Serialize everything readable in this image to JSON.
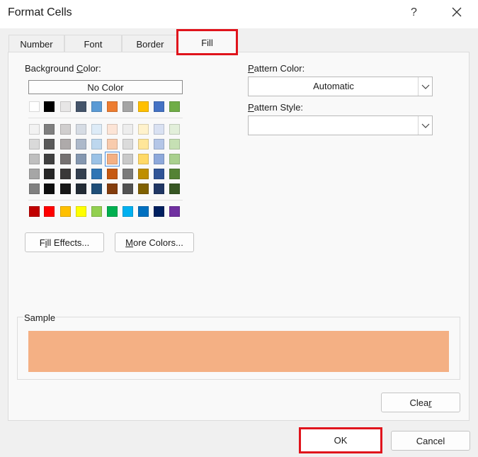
{
  "window": {
    "title": "Format Cells",
    "help_label": "?",
    "close_icon": "close-icon"
  },
  "tabs": [
    {
      "label": "Number"
    },
    {
      "label": "Font"
    },
    {
      "label": "Border"
    },
    {
      "label": "Fill"
    }
  ],
  "active_tab": "Fill",
  "fill": {
    "background_color_label_pre": "Background ",
    "background_color_label_key": "C",
    "background_color_label_post": "olor:",
    "no_color_label": "No Color",
    "theme_row": [
      "#ffffff",
      "#000000",
      "#e7e6e6",
      "#44546a",
      "#5b9bd5",
      "#ed7d31",
      "#a5a5a5",
      "#ffc000",
      "#4472c4",
      "#70ad47"
    ],
    "tint_rows": [
      [
        "#f2f2f2",
        "#7f7f7f",
        "#d0cece",
        "#d6dce4",
        "#ddebf7",
        "#fce4d6",
        "#ededed",
        "#fff2cc",
        "#d9e1f2",
        "#e2efda"
      ],
      [
        "#d9d9d9",
        "#595959",
        "#aeaaaa",
        "#adb9ca",
        "#bdd7ee",
        "#f8cbad",
        "#dbdbdb",
        "#ffe699",
        "#b4c6e7",
        "#c6e0b4"
      ],
      [
        "#bfbfbf",
        "#404040",
        "#757171",
        "#8497b0",
        "#9bc2e6",
        "#f4b084",
        "#c9c9c9",
        "#ffd966",
        "#8ea9db",
        "#a9d08e"
      ],
      [
        "#a6a6a6",
        "#262626",
        "#3a3838",
        "#333f4f",
        "#2f75b5",
        "#c65911",
        "#7b7b7b",
        "#bf8f00",
        "#305496",
        "#548235"
      ],
      [
        "#808080",
        "#0d0d0d",
        "#161616",
        "#222b35",
        "#1f4e78",
        "#833c0c",
        "#525252",
        "#7f6000",
        "#203764",
        "#375623"
      ]
    ],
    "standard_row": [
      "#c00000",
      "#ff0000",
      "#ffc000",
      "#ffff00",
      "#92d050",
      "#00b050",
      "#00b0f0",
      "#0070c0",
      "#002060",
      "#7030a0"
    ],
    "selected_swatch": "#f4b084",
    "fill_effects_label_key": "i",
    "fill_effects_label_pre": "F",
    "fill_effects_label_post": "ll Effects...",
    "more_colors_label_key": "M",
    "more_colors_label_post": "ore Colors...",
    "pattern_color_label_key": "P",
    "pattern_color_label_post": "attern Color:",
    "pattern_color_value": "Automatic",
    "pattern_style_label_key": "P",
    "pattern_style_label_post": "attern Style:",
    "pattern_style_value": "",
    "sample_label": "Sample",
    "sample_color": "#f4b084",
    "clear_label_pre": "C",
    "clear_label_mid": "lea",
    "clear_label_key": "r"
  },
  "footer": {
    "ok_label": "OK",
    "cancel_label": "Cancel"
  }
}
